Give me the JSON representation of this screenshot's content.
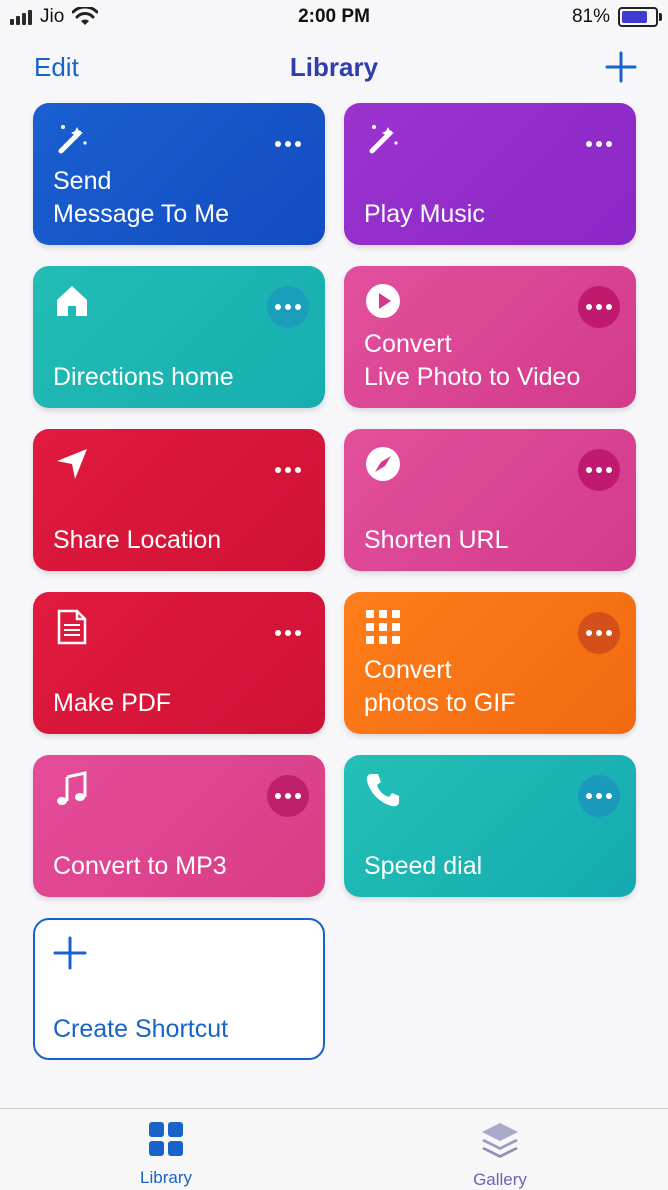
{
  "status": {
    "carrier": "Jio",
    "time": "2:00 PM",
    "battery": "81%"
  },
  "nav": {
    "edit": "Edit",
    "title": "Library"
  },
  "cards": [
    {
      "label": "Send\nMessage To Me",
      "icon": "magic-wand-icon"
    },
    {
      "label": "Play Music",
      "icon": "magic-wand-icon"
    },
    {
      "label": "Directions home",
      "icon": "home-icon"
    },
    {
      "label": "Convert\nLive Photo to Video",
      "icon": "play-icon"
    },
    {
      "label": "Share Location",
      "icon": "location-arrow-icon"
    },
    {
      "label": "Shorten URL",
      "icon": "compass-icon"
    },
    {
      "label": "Make PDF",
      "icon": "document-icon"
    },
    {
      "label": "Convert\nphotos to GIF",
      "icon": "grid-icon"
    },
    {
      "label": "Convert to MP3",
      "icon": "music-note-icon"
    },
    {
      "label": "Speed dial",
      "icon": "phone-icon"
    }
  ],
  "create": {
    "label": "Create Shortcut"
  },
  "tabs": {
    "library": "Library",
    "gallery": "Gallery"
  },
  "colors": {
    "accent": "#1763c9",
    "title": "#2f3ea8"
  }
}
